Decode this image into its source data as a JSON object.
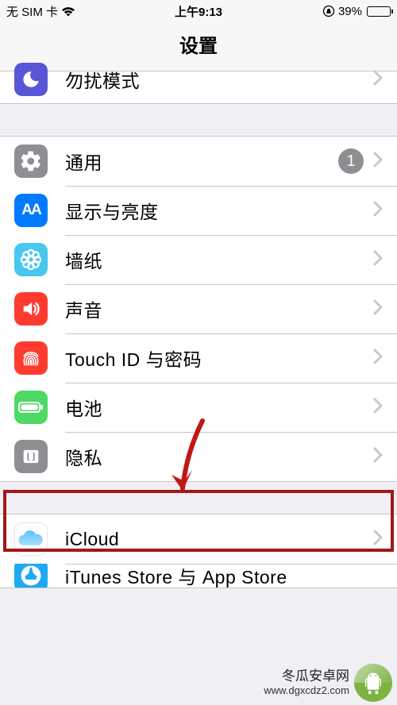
{
  "status": {
    "carrier": "无 SIM 卡",
    "time": "上午9:13",
    "battery_pct": "39%"
  },
  "nav": {
    "title": "设置"
  },
  "rows": {
    "dnd": {
      "label": "勿扰模式"
    },
    "general": {
      "label": "通用",
      "badge": "1"
    },
    "display": {
      "label": "显示与亮度"
    },
    "wallpaper": {
      "label": "墙纸"
    },
    "sound": {
      "label": "声音"
    },
    "touchid": {
      "label": "Touch ID 与密码"
    },
    "battery": {
      "label": "电池"
    },
    "privacy": {
      "label": "隐私"
    },
    "icloud": {
      "label": "iCloud"
    },
    "appstore": {
      "label": "iTunes Store 与 App Store"
    }
  },
  "watermark": {
    "name": "冬瓜安卓网",
    "url": "www.dgxcdz2.com"
  }
}
